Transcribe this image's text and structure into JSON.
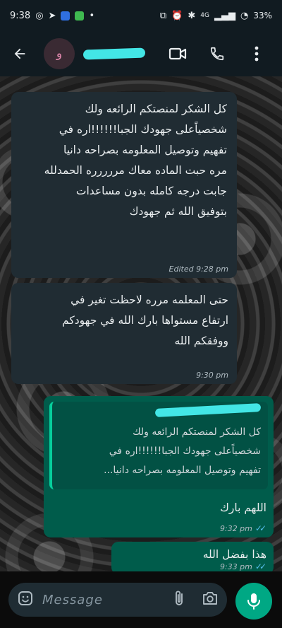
{
  "status_bar": {
    "time": "9:38",
    "battery": "33%",
    "network": "4G"
  },
  "header": {
    "avatar_letter": "و"
  },
  "messages": [
    {
      "text": "كل الشكر لمنصتكم الرائعه ولك\nشخصياًعلى جهودك الجبا!!!!!!اره في\nتفهيم وتوصيل المعلومه بصراحه دانيا\nمره حبت الماده معاك مررررره الحمدلله\nجابت درجه كامله بدون  مساعدات\nبتوفيق الله ثم جهودك",
      "meta": "Edited 9:28 pm"
    },
    {
      "text": "حتى المعلمه مرره لاحظت تغير في\nارتفاع مستواها بارك الله في جهودكم\nووفقكم الله",
      "meta": "9:30 pm"
    },
    {
      "quote": "كل الشكر لمنصتكم الرائعه ولك\nشخصياًعلى جهودك الجبا!!!!!!اره في\nتفهيم وتوصيل المعلومه بصراحه دانيا...",
      "text": "اللهم بارك",
      "meta": "9:32 pm"
    },
    {
      "text": "هذا بفضل الله",
      "meta": "9:33 pm"
    }
  ],
  "input": {
    "placeholder": "Message"
  },
  "icons": {
    "back": "arrow-left-icon",
    "video": "video-call-icon",
    "phone": "phone-icon",
    "menu": "more-vert-icon",
    "sticker": "sticker-icon",
    "attach": "paperclip-icon",
    "camera": "camera-icon",
    "mic": "microphone-icon"
  },
  "colors": {
    "header_bg": "#111b21",
    "incoming_bubble": "#202c33",
    "outgoing_bubble": "#005c4b",
    "accent": "#00a884",
    "read_ticks": "#53bdeb"
  }
}
